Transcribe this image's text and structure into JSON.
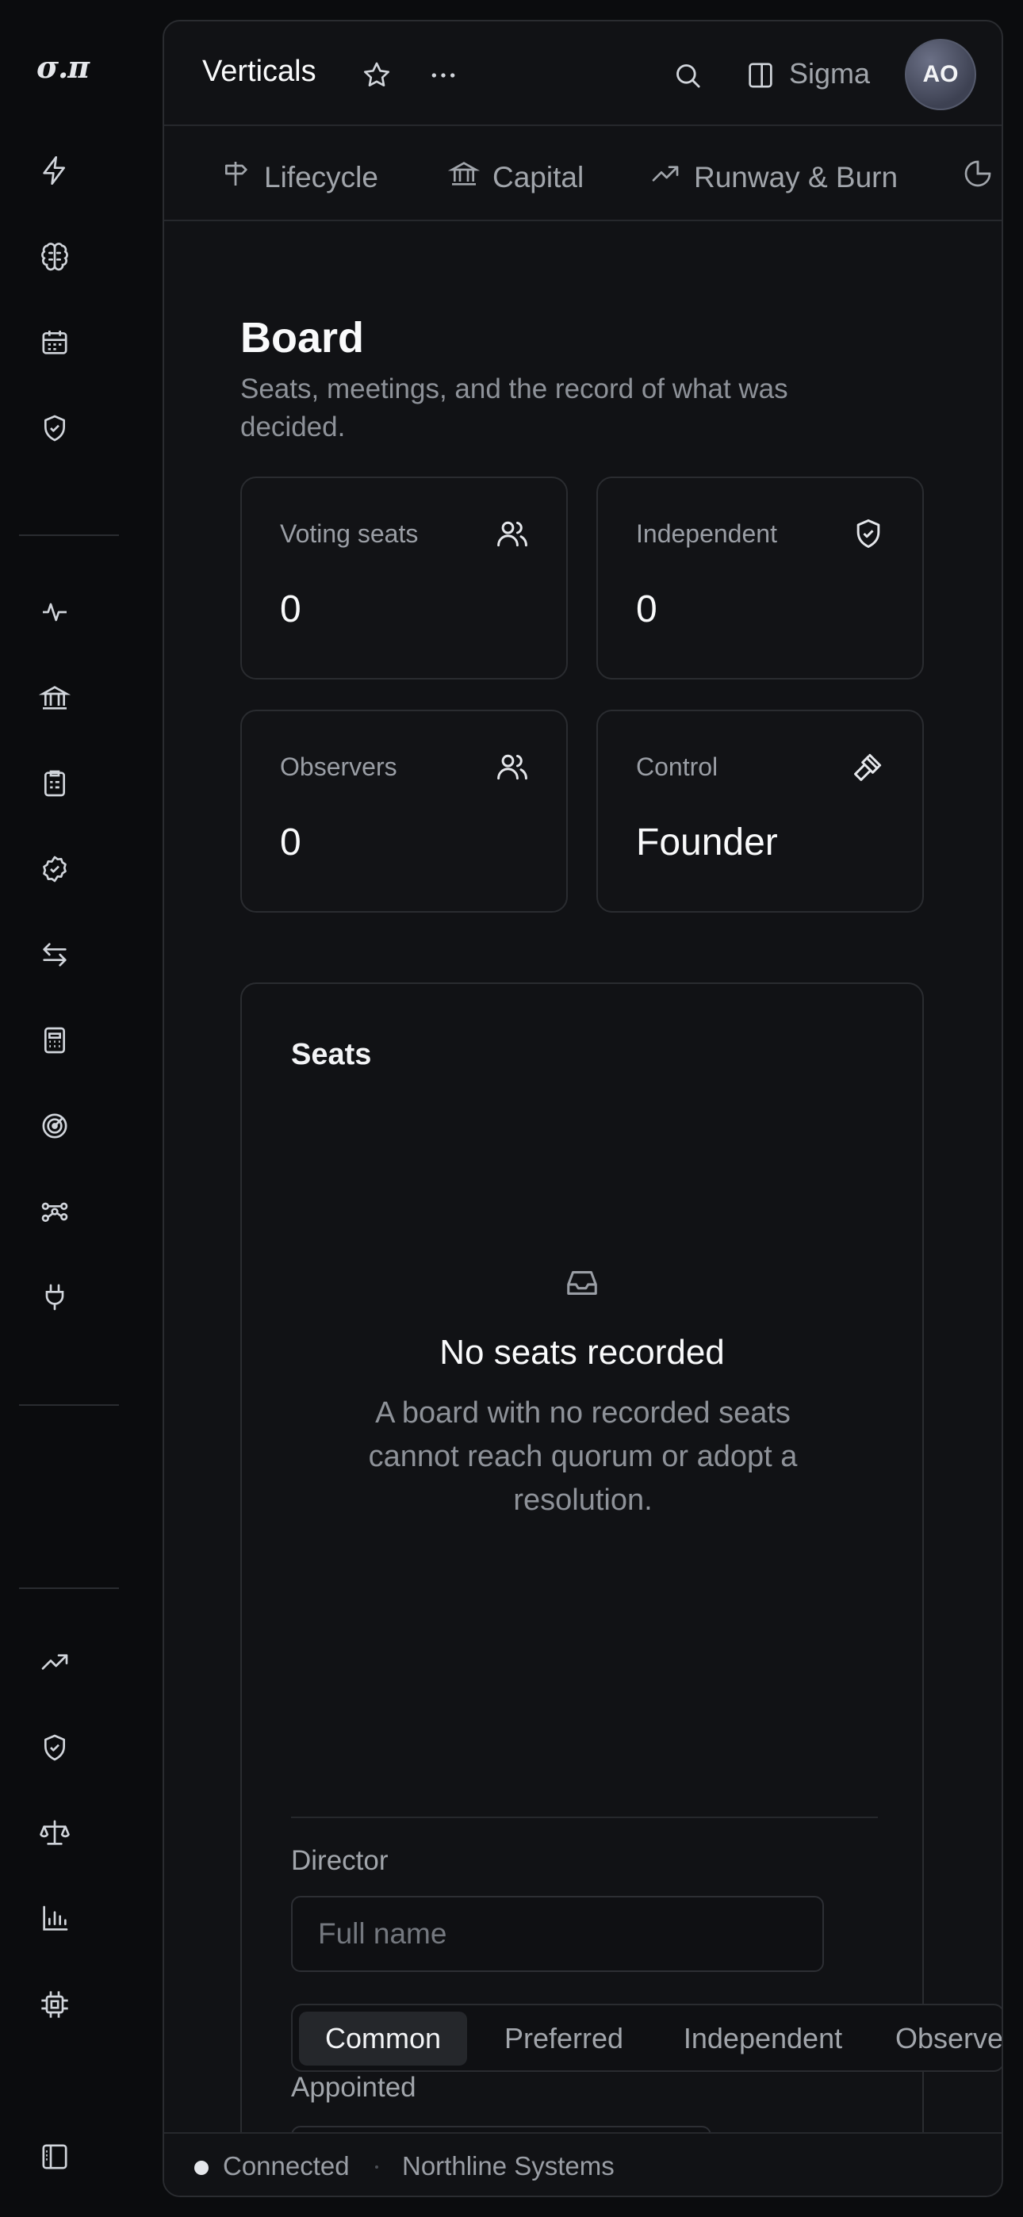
{
  "rail": {
    "logo": "σ.π",
    "icons": [
      "bolt-icon",
      "brain-icon",
      "calendar-icon",
      "shield-check-icon",
      "activity-icon",
      "bank-icon",
      "clipboard-icon",
      "badge-check-icon",
      "arrows-exchange-icon",
      "calculator-icon",
      "radar-icon",
      "workflow-icon",
      "plug-icon",
      "trending-up-icon",
      "shield-check-icon",
      "scale-icon",
      "bar-chart-icon",
      "chip-icon",
      "sidebar-toggle-icon"
    ]
  },
  "header": {
    "title": "Verticals",
    "workspace": "Sigma",
    "avatar_initials": "AO"
  },
  "tabs": [
    {
      "label": "Lifecycle",
      "icon": "signpost-icon"
    },
    {
      "label": "Capital",
      "icon": "bank-icon"
    },
    {
      "label": "Runway & Burn",
      "icon": "trending-up-icon"
    },
    {
      "label": "",
      "icon": "pie-chart-icon"
    }
  ],
  "page": {
    "title": "Board",
    "subtitle": "Seats, meetings, and the record of what was decided."
  },
  "stats": [
    {
      "label": "Voting seats",
      "value": "0",
      "icon": "users-icon"
    },
    {
      "label": "Independent",
      "value": "0",
      "icon": "shield-check-icon"
    },
    {
      "label": "Observers",
      "value": "0",
      "icon": "users-icon"
    },
    {
      "label": "Control",
      "value": "Founder",
      "icon": "gavel-icon"
    }
  ],
  "seats": {
    "title": "Seats",
    "empty_title": "No seats recorded",
    "empty_body": "A board with no recorded seats cannot reach quorum or adopt a resolution.",
    "director_label": "Director",
    "director_placeholder": "Full name",
    "classes": [
      "Common",
      "Preferred",
      "Independent",
      "Observer"
    ],
    "selected_class": "Common",
    "appointed_label": "Appointed"
  },
  "status": {
    "connection": "Connected",
    "organization": "Northline Systems"
  }
}
